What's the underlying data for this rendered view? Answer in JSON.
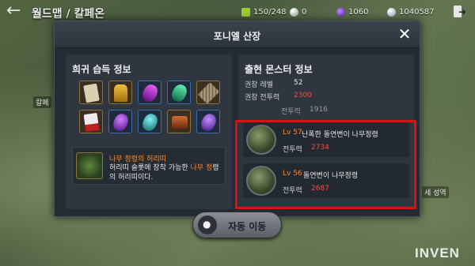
{
  "topbar": {
    "title": "월드맵 / 칼페온",
    "resources": [
      {
        "icon": "energy-icon",
        "value": "150/248",
        "color": "#9acd32"
      },
      {
        "icon": "pearl-icon",
        "value": "0",
        "color": "#d8d8d8"
      },
      {
        "icon": "crystal-icon",
        "value": "1060",
        "color": "#8a4ad8"
      },
      {
        "icon": "silver-icon",
        "value": "1040587",
        "color": "#c8d8e8"
      }
    ]
  },
  "map_labels": [
    "칼페",
    "세 성역"
  ],
  "dialog": {
    "title": "포니엘 산장",
    "left": {
      "title": "희귀 습득 정보",
      "items": [
        {
          "icon": "scroll-check-icon",
          "color": "#d8d0b0"
        },
        {
          "icon": "golden-trophy-icon",
          "color": "#d8a020"
        },
        {
          "icon": "purple-crystal-icon",
          "color": "#a030c0"
        },
        {
          "icon": "green-crystal-icon",
          "color": "#30b080"
        },
        {
          "icon": "stone-tablet-icon",
          "color": "#a09070"
        },
        {
          "icon": "red-scroll-icon",
          "color": "#e8e0e0"
        },
        {
          "icon": "purple-gem-icon",
          "color": "#8a30c8"
        },
        {
          "icon": "teal-gem-icon",
          "color": "#20a0a0"
        },
        {
          "icon": "treasure-chest-icon",
          "color": "#c06020"
        },
        {
          "icon": "violet-gem-icon",
          "color": "#9040d0"
        }
      ],
      "detail": {
        "name": "나무 정령의 허리띠",
        "text_before": "허리띠 슬롯에 장착 가능한 ",
        "text_highlight": "나무 정",
        "text_after": "령의 허리띠이다."
      }
    },
    "right": {
      "title": "출현 몬스터 정보",
      "level_label": "권장 레벨",
      "level_value": "52",
      "power_label": "권장 전투력",
      "power_value": "2300",
      "partial_label": "전투력",
      "partial_value": "1916",
      "monsters": [
        {
          "level": "Lv 57",
          "name": "난폭한 돌연변이 나무정령",
          "power_label": "전투력",
          "power": "2734"
        },
        {
          "level": "Lv 56",
          "name": "돌연변이 나무정령",
          "power_label": "전투력",
          "power": "2687"
        }
      ]
    }
  },
  "auto_move": {
    "label": "자동 이동"
  },
  "watermark": "INVEN"
}
